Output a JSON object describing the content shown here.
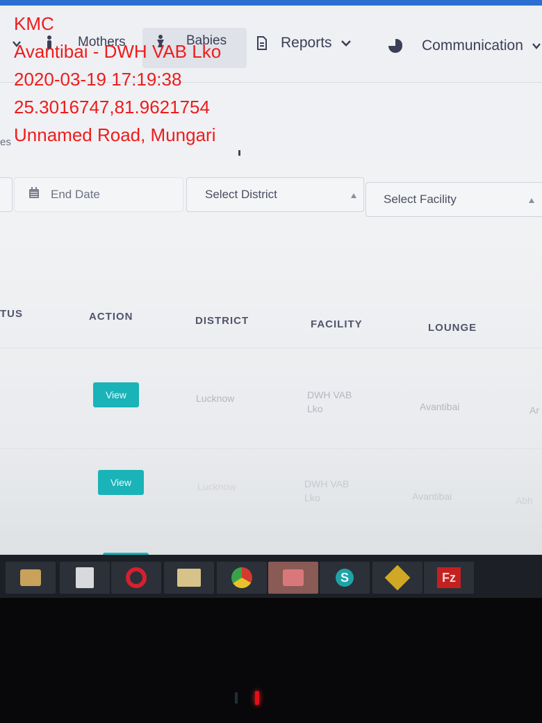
{
  "overlay": {
    "line1": "KMC",
    "line2": "Avantibai - DWH VAB Lko",
    "line3": "2020-03-19 17:19:38",
    "line4": "25.3016747,81.9621754",
    "line5": "Unnamed Road, Mungari"
  },
  "nav": {
    "mothers": "Mothers",
    "babies": "Babies",
    "reports": "Reports",
    "communication": "Communication",
    "breadcrumb_fragment": "es"
  },
  "filters": {
    "end_date_placeholder": "End Date",
    "district_placeholder": "Select District",
    "facility_placeholder": "Select Facility"
  },
  "table": {
    "headers": [
      "TUS",
      "ACTION",
      "DISTRICT",
      "FACILITY",
      "LOUNGE"
    ],
    "rows": [
      {
        "action": "View",
        "district": "Lucknow",
        "facility_line1": "DWH VAB",
        "facility_line2": "Lko",
        "lounge": "Avantibai",
        "extra": "Ar"
      },
      {
        "action": "View",
        "district": "Lucknow",
        "facility_line1": "DWH VAB",
        "facility_line2": "Lko",
        "lounge": "Avantibai",
        "extra": "Abh"
      }
    ]
  },
  "colors": {
    "overlay_text": "#ee1c1c",
    "view_button": "#19b3b8",
    "led": "#e3101a"
  },
  "icons": [
    "calendar-icon",
    "document-icon",
    "pie-chart-icon",
    "chevron-down-icon",
    "taskbar-app-icon"
  ]
}
